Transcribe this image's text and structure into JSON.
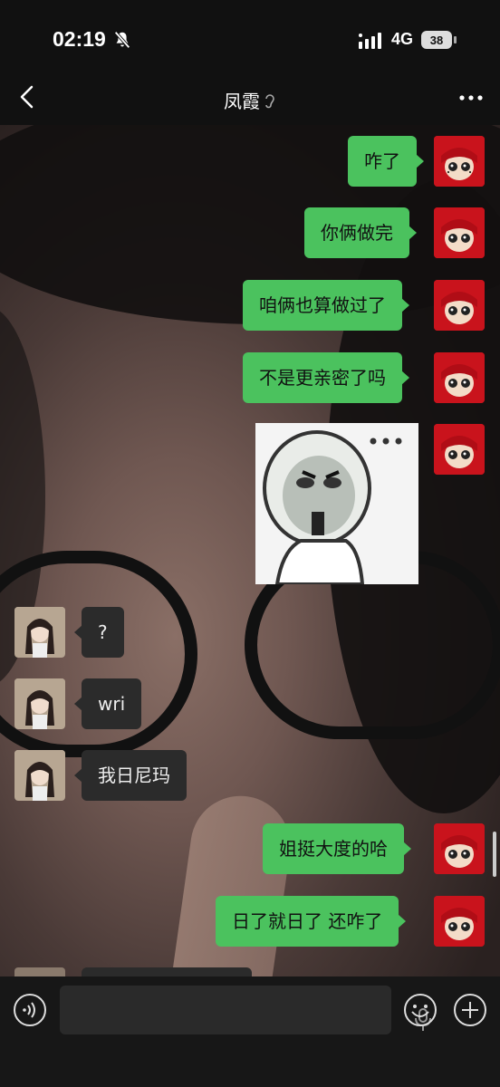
{
  "status_bar": {
    "time": "02:19",
    "network": "4G",
    "battery": "38"
  },
  "header": {
    "title": "凤霞"
  },
  "messages": [
    {
      "from": "me",
      "text": "咋了"
    },
    {
      "from": "me",
      "text": "你俩做完"
    },
    {
      "from": "me",
      "text": "咱俩也算做过了"
    },
    {
      "from": "me",
      "text": "不是更亲密了吗"
    },
    {
      "from": "me",
      "type": "sticker"
    },
    {
      "from": "other",
      "text": "?"
    },
    {
      "from": "other",
      "text": "wri"
    },
    {
      "from": "other",
      "text": "我日尼玛"
    },
    {
      "from": "me",
      "text": "姐挺大度的哈"
    },
    {
      "from": "me",
      "text": "日了就日了 还咋了"
    }
  ],
  "colors": {
    "my_bubble": "#4bc25e",
    "other_bubble": "#2b2b2b",
    "bar_bg": "#111111"
  }
}
